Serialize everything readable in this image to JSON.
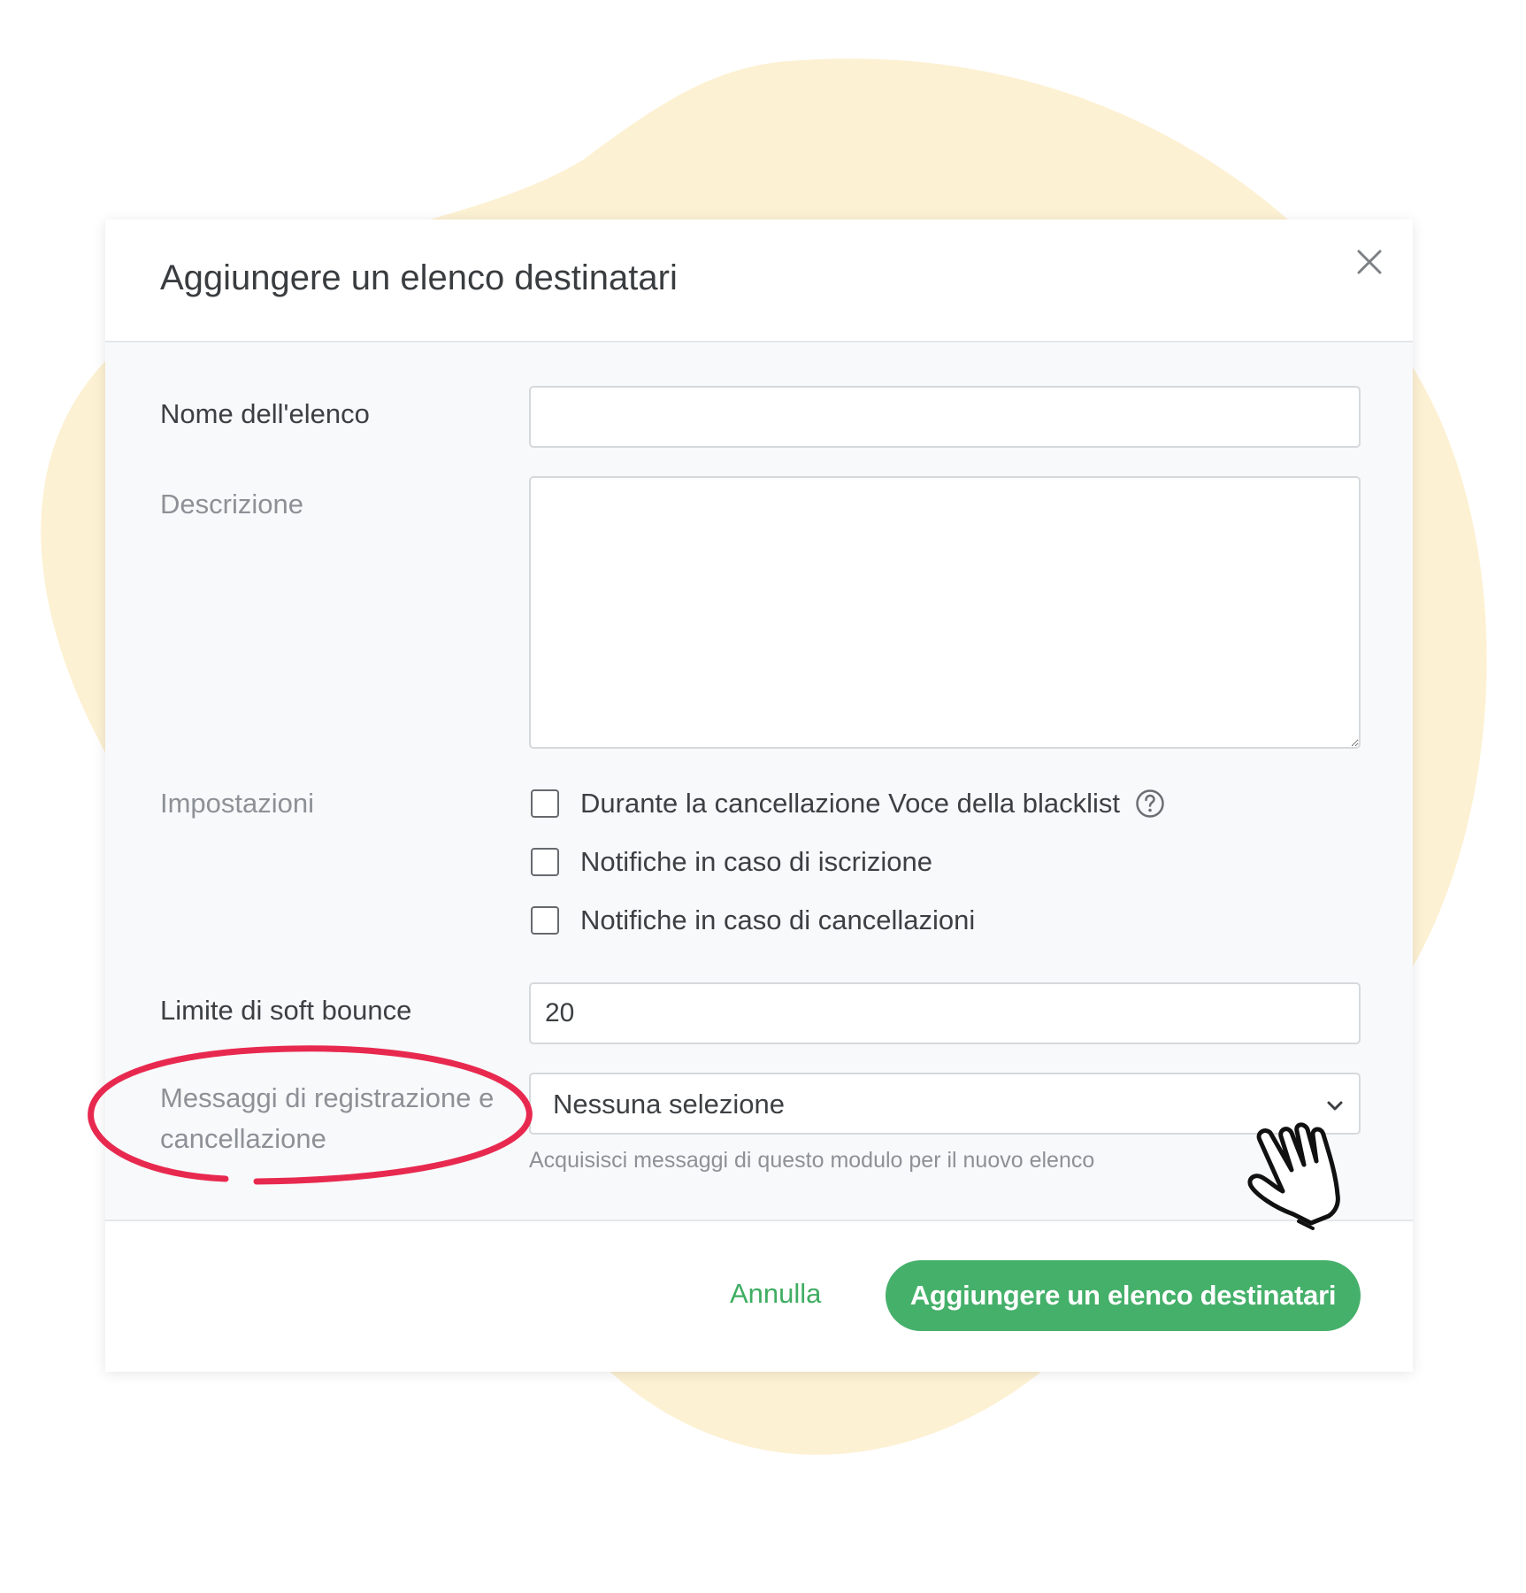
{
  "colors": {
    "blob": "#fdf1d3",
    "accent_green": "#45b06a",
    "highlight_red": "#e8294f"
  },
  "dialog": {
    "title": "Aggiungere un elenco destinatari",
    "close_icon": "close-icon"
  },
  "form": {
    "name_label": "Nome dell'elenco",
    "name_value": "",
    "description_label": "Descrizione",
    "description_value": "",
    "settings_label": "Impostazioni",
    "checkboxes": [
      {
        "label": "Durante la cancellazione Voce della blacklist",
        "checked": false,
        "has_help": true
      },
      {
        "label": "Notifiche in caso di iscrizione",
        "checked": false
      },
      {
        "label": "Notifiche in caso di cancellazioni",
        "checked": false
      }
    ],
    "soft_bounce_label": "Limite di soft bounce",
    "soft_bounce_value": "20",
    "messages_label_line1": "Messaggi di registrazione e",
    "messages_label_line2": "cancellazione",
    "messages_select_value": "Nessuna selezione",
    "messages_hint": "Acquisisci messaggi di questo modulo per il nuovo elenco"
  },
  "footer": {
    "cancel_label": "Annulla",
    "submit_label": "Aggiungere un elenco destinatari"
  },
  "annotations": {
    "highlight": "ellipse-annotation",
    "cursor": "hand-pointer-icon"
  }
}
